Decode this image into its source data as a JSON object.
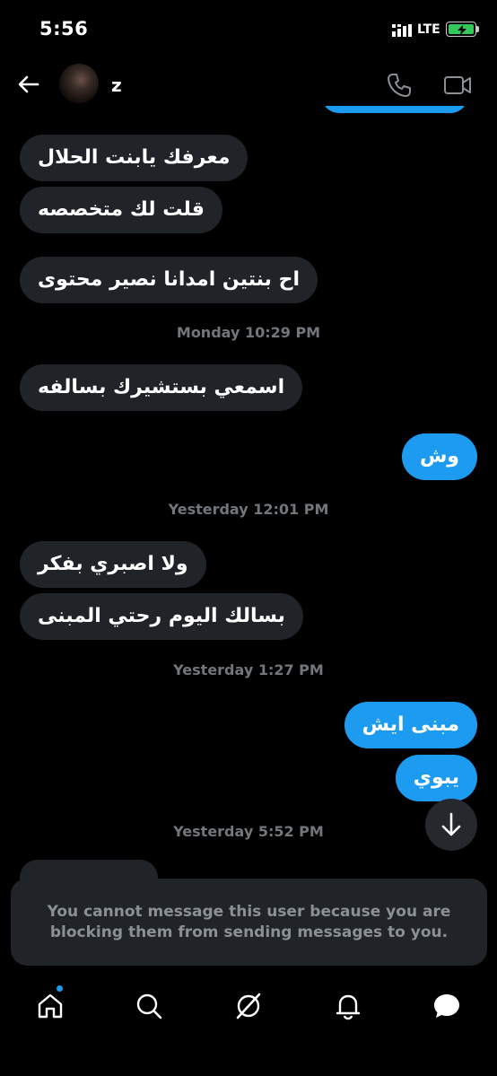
{
  "status_bar": {
    "time": "5:56",
    "network": "LTE",
    "battery_color": "#34c759"
  },
  "header": {
    "contact_name": "z",
    "back_icon": "arrow-left-icon",
    "call_icon": "phone-icon",
    "video_icon": "video-camera-icon"
  },
  "messages": [
    {
      "type": "received",
      "text": "معرفك يابنت الحلال"
    },
    {
      "type": "received",
      "text": "قلت لك متخصصه"
    },
    {
      "type": "received",
      "text": "اح بنتين امدانا نصير محتوى"
    },
    {
      "type": "timestamp",
      "text": "Monday 10:29 PM"
    },
    {
      "type": "received",
      "text": "اسمعي بستشيرك بسالفه"
    },
    {
      "type": "sent",
      "text": "وش"
    },
    {
      "type": "timestamp",
      "text": "Yesterday 12:01 PM"
    },
    {
      "type": "received",
      "text": "ولا اصبري بفكر"
    },
    {
      "type": "received",
      "text": "بسالك اليوم رحتي المبنى"
    },
    {
      "type": "timestamp",
      "text": "Yesterday 1:27 PM"
    },
    {
      "type": "sent",
      "text": "مبنى ايش"
    },
    {
      "type": "sent",
      "text": "يبوي"
    },
    {
      "type": "timestamp",
      "text": "Yesterday 5:52 PM"
    }
  ],
  "blocked_notice": "You cannot message this user because you are blocking them from sending messages to you.",
  "nav": {
    "items": [
      "home-icon",
      "search-icon",
      "grok-icon",
      "notifications-icon",
      "messages-icon"
    ],
    "accent": "#1d9bf0"
  }
}
